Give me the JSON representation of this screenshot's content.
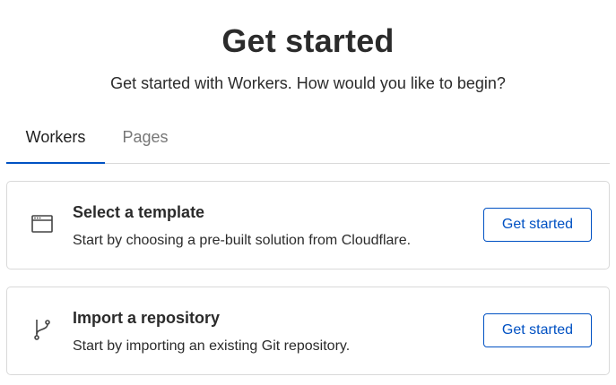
{
  "header": {
    "title": "Get started",
    "subtitle": "Get started with Workers. How would you like to begin?"
  },
  "tabs": [
    {
      "label": "Workers",
      "selected": true
    },
    {
      "label": "Pages",
      "selected": false
    }
  ],
  "cards": [
    {
      "icon": "browser-window-icon",
      "title": "Select a template",
      "description": "Start by choosing a pre-built solution from Cloudflare.",
      "button_label": "Get started"
    },
    {
      "icon": "git-branch-icon",
      "title": "Import a repository",
      "description": "Start by importing an existing Git repository.",
      "button_label": "Get started"
    }
  ],
  "colors": {
    "accent": "#0051c3",
    "text": "#2b2b2b",
    "muted": "#777777",
    "border": "#d9d9d9"
  }
}
